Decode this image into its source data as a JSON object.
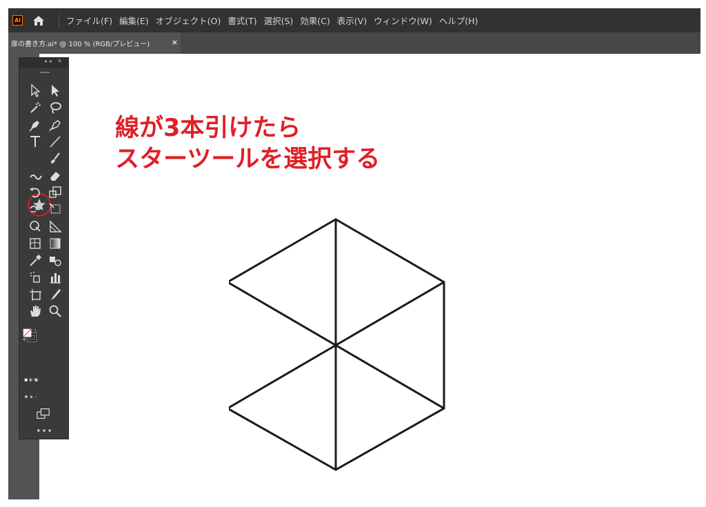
{
  "app": {
    "logo_text": "Ai"
  },
  "menu": {
    "items": [
      "ファイル(F)",
      "編集(E)",
      "オブジェクト(O)",
      "書式(T)",
      "選択(S)",
      "効果(C)",
      "表示(V)",
      "ウィンドウ(W)",
      "ヘルプ(H)"
    ]
  },
  "document_tab": {
    "label": "扉の書き方.ai* @ 100 % (RGB/プレビュー)",
    "close": "×"
  },
  "toolbar": {
    "more": "•••",
    "selected_tool": "star-tool",
    "tools": [
      "selection",
      "direct-selection",
      "magic-wand",
      "lasso",
      "pen",
      "curvature",
      "type",
      "line-segment",
      "star",
      "paintbrush",
      "shaper",
      "eraser",
      "rotate",
      "scale",
      "warp",
      "free-transform",
      "shape-builder",
      "perspective-grid",
      "mesh",
      "gradient",
      "eyedropper",
      "blend",
      "symbol-sprayer",
      "column-graph",
      "artboard",
      "slice",
      "hand",
      "zoom"
    ]
  },
  "annotation": {
    "line1": "線が3本引けたら",
    "line2": "スターツールを選択する",
    "color": "#e01f26"
  },
  "colors": {
    "menubar": "#323232",
    "workspace": "#535353",
    "highlight": "#d81b24"
  }
}
